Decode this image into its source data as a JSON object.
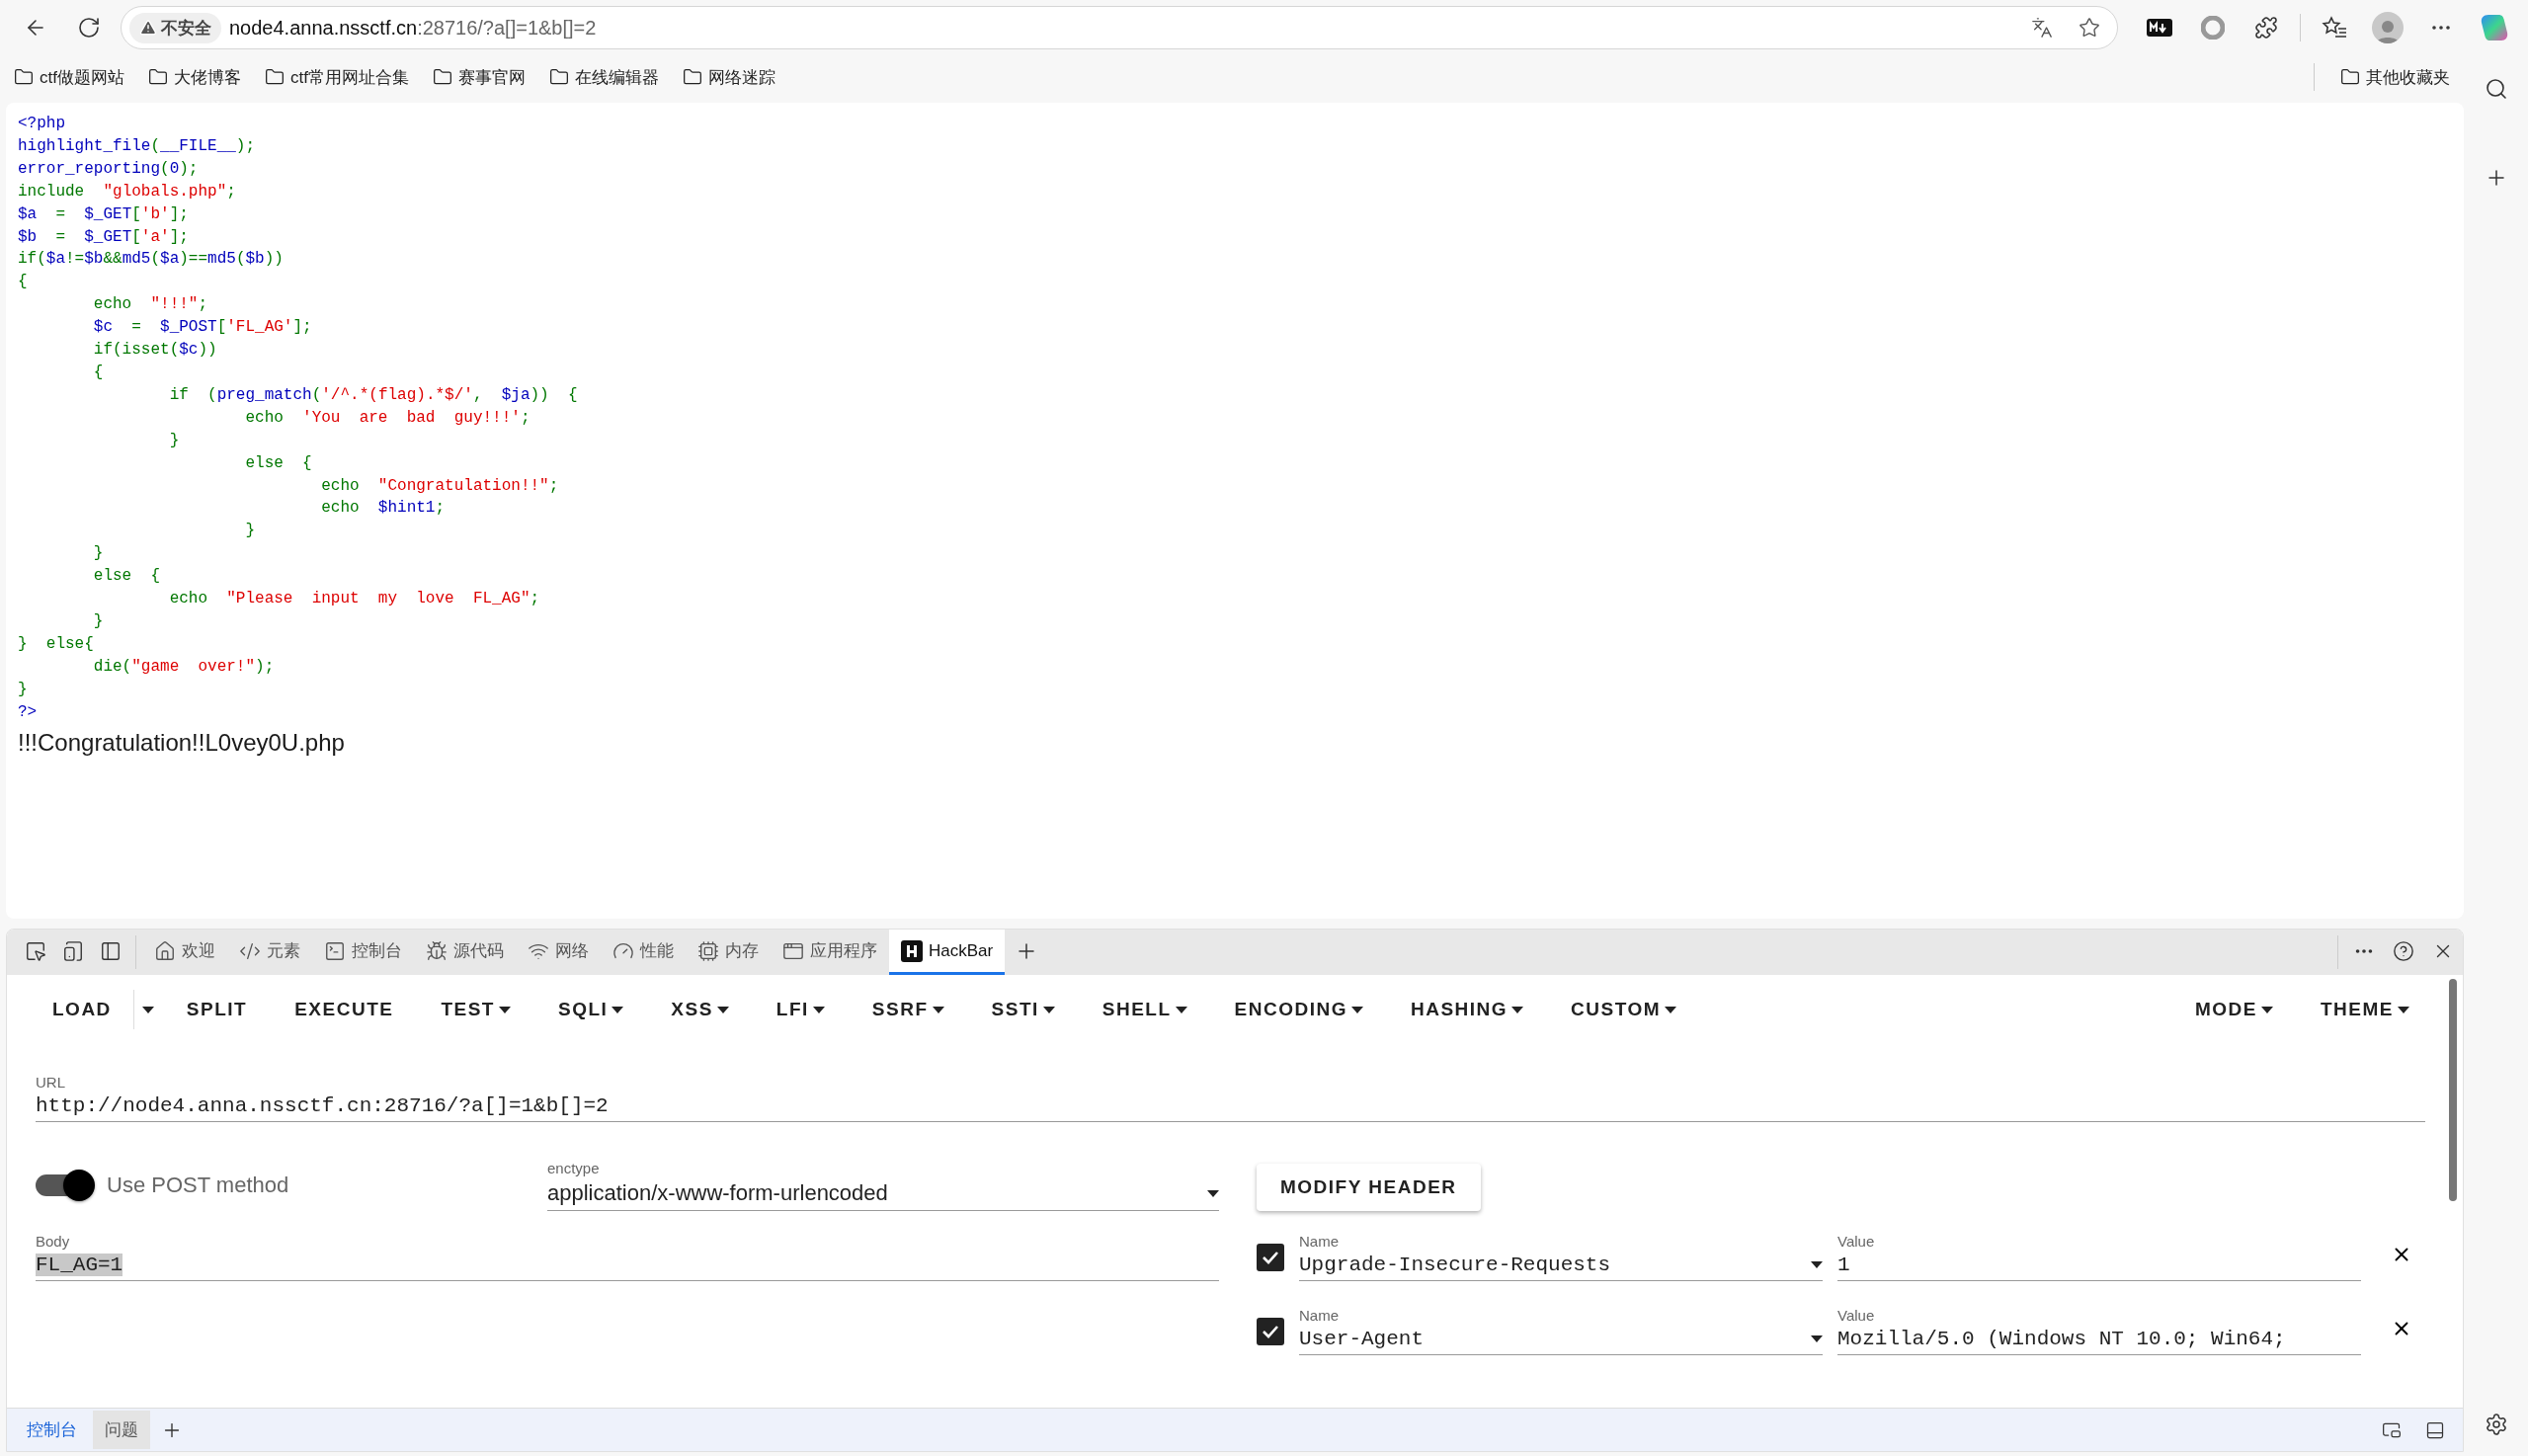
{
  "browser": {
    "address": {
      "security_label": "不安全",
      "host": "node4.anna.nssctf.cn",
      "path": ":28716/?a[]=1&b[]=2"
    },
    "bookmarks": [
      "ctf做题网站",
      "大佬博客",
      "ctf常用网址合集",
      "赛事官网",
      "在线编辑器",
      "网络迷踪"
    ],
    "other_bookmarks": "其他收藏夹"
  },
  "page": {
    "code_lines": [
      [
        {
          "kind": "default",
          "text": "<?php"
        }
      ],
      [
        {
          "kind": "default",
          "text": "highlight_file"
        },
        {
          "kind": "keyword",
          "text": "("
        },
        {
          "kind": "default",
          "text": "__FILE__"
        },
        {
          "kind": "keyword",
          "text": ");"
        }
      ],
      [
        {
          "kind": "default",
          "text": "error_reporting"
        },
        {
          "kind": "keyword",
          "text": "("
        },
        {
          "kind": "default",
          "text": "0"
        },
        {
          "kind": "keyword",
          "text": ");"
        }
      ],
      [
        {
          "kind": "keyword",
          "text": "include  "
        },
        {
          "kind": "string",
          "text": "\"globals.php\""
        },
        {
          "kind": "keyword",
          "text": ";"
        }
      ],
      [
        {
          "kind": "default",
          "text": "$a  "
        },
        {
          "kind": "keyword",
          "text": "=  "
        },
        {
          "kind": "default",
          "text": "$_GET"
        },
        {
          "kind": "keyword",
          "text": "["
        },
        {
          "kind": "string",
          "text": "'b'"
        },
        {
          "kind": "keyword",
          "text": "];"
        }
      ],
      [
        {
          "kind": "default",
          "text": "$b  "
        },
        {
          "kind": "keyword",
          "text": "=  "
        },
        {
          "kind": "default",
          "text": "$_GET"
        },
        {
          "kind": "keyword",
          "text": "["
        },
        {
          "kind": "string",
          "text": "'a'"
        },
        {
          "kind": "keyword",
          "text": "];"
        }
      ],
      [
        {
          "kind": "keyword",
          "text": "if("
        },
        {
          "kind": "default",
          "text": "$a"
        },
        {
          "kind": "keyword",
          "text": "!="
        },
        {
          "kind": "default",
          "text": "$b"
        },
        {
          "kind": "keyword",
          "text": "&&"
        },
        {
          "kind": "default",
          "text": "md5"
        },
        {
          "kind": "keyword",
          "text": "("
        },
        {
          "kind": "default",
          "text": "$a"
        },
        {
          "kind": "keyword",
          "text": ")=="
        },
        {
          "kind": "default",
          "text": "md5"
        },
        {
          "kind": "keyword",
          "text": "("
        },
        {
          "kind": "default",
          "text": "$b"
        },
        {
          "kind": "keyword",
          "text": "))"
        }
      ],
      [
        {
          "kind": "keyword",
          "text": "{"
        }
      ],
      [
        {
          "kind": "keyword",
          "text": "        echo  "
        },
        {
          "kind": "string",
          "text": "\"!!!\""
        },
        {
          "kind": "keyword",
          "text": ";"
        }
      ],
      [
        {
          "kind": "default",
          "text": "        $c  "
        },
        {
          "kind": "keyword",
          "text": "=  "
        },
        {
          "kind": "default",
          "text": "$_POST"
        },
        {
          "kind": "keyword",
          "text": "["
        },
        {
          "kind": "string",
          "text": "'FL_AG'"
        },
        {
          "kind": "keyword",
          "text": "];"
        }
      ],
      [
        {
          "kind": "keyword",
          "text": "        if(isset("
        },
        {
          "kind": "default",
          "text": "$c"
        },
        {
          "kind": "keyword",
          "text": "))"
        }
      ],
      [
        {
          "kind": "keyword",
          "text": "        {"
        }
      ],
      [
        {
          "kind": "keyword",
          "text": "                if  ("
        },
        {
          "kind": "default",
          "text": "preg_match"
        },
        {
          "kind": "keyword",
          "text": "("
        },
        {
          "kind": "string",
          "text": "'/^.*(flag).*$/'"
        },
        {
          "kind": "keyword",
          "text": ",  "
        },
        {
          "kind": "default",
          "text": "$ja"
        },
        {
          "kind": "keyword",
          "text": "))  {"
        }
      ],
      [
        {
          "kind": "keyword",
          "text": "                        echo  "
        },
        {
          "kind": "string",
          "text": "'You  are  bad  guy!!!'"
        },
        {
          "kind": "keyword",
          "text": ";"
        }
      ],
      [
        {
          "kind": "keyword",
          "text": "                }"
        }
      ],
      [
        {
          "kind": "keyword",
          "text": "                        else  {"
        }
      ],
      [
        {
          "kind": "keyword",
          "text": "                                echo  "
        },
        {
          "kind": "string",
          "text": "\"Congratulation!!\""
        },
        {
          "kind": "keyword",
          "text": ";"
        }
      ],
      [
        {
          "kind": "keyword",
          "text": "                                echo  "
        },
        {
          "kind": "default",
          "text": "$hint1"
        },
        {
          "kind": "keyword",
          "text": ";"
        }
      ],
      [
        {
          "kind": "keyword",
          "text": "                        }"
        }
      ],
      [
        {
          "kind": "keyword",
          "text": "        }"
        }
      ],
      [
        {
          "kind": "keyword",
          "text": "        else  {"
        }
      ],
      [
        {
          "kind": "keyword",
          "text": "                echo  "
        },
        {
          "kind": "string",
          "text": "\"Please  input  my  love  FL_AG\""
        },
        {
          "kind": "keyword",
          "text": ";"
        }
      ],
      [
        {
          "kind": "keyword",
          "text": "        }"
        }
      ],
      [
        {
          "kind": "keyword",
          "text": "}  else{"
        }
      ],
      [
        {
          "kind": "keyword",
          "text": "        die("
        },
        {
          "kind": "string",
          "text": "\"game  over!\""
        },
        {
          "kind": "keyword",
          "text": ");"
        }
      ],
      [
        {
          "kind": "keyword",
          "text": "}"
        }
      ],
      [
        {
          "kind": "default",
          "text": "?>"
        }
      ]
    ],
    "output": "!!!Congratulation!!L0vey0U.php"
  },
  "devtools": {
    "tabs": [
      {
        "label": "欢迎",
        "selected": false
      },
      {
        "label": "元素",
        "selected": false
      },
      {
        "label": "控制台",
        "selected": false
      },
      {
        "label": "源代码",
        "selected": false
      },
      {
        "label": "网络",
        "selected": false
      },
      {
        "label": "性能",
        "selected": false
      },
      {
        "label": "内存",
        "selected": false
      },
      {
        "label": "应用程序",
        "selected": false
      },
      {
        "label": "HackBar",
        "selected": true
      }
    ],
    "hackbar": {
      "menu": [
        {
          "label": "LOAD",
          "kind": "split"
        },
        {
          "label": "SPLIT",
          "kind": "plain"
        },
        {
          "label": "EXECUTE",
          "kind": "plain"
        },
        {
          "label": "TEST",
          "kind": "dropdown"
        },
        {
          "label": "SQLI",
          "kind": "dropdown"
        },
        {
          "label": "XSS",
          "kind": "dropdown"
        },
        {
          "label": "LFI",
          "kind": "dropdown"
        },
        {
          "label": "SSRF",
          "kind": "dropdown"
        },
        {
          "label": "SSTI",
          "kind": "dropdown"
        },
        {
          "label": "SHELL",
          "kind": "dropdown"
        },
        {
          "label": "ENCODING",
          "kind": "dropdown"
        },
        {
          "label": "HASHING",
          "kind": "dropdown"
        },
        {
          "label": "CUSTOM",
          "kind": "dropdown"
        }
      ],
      "menu_right": [
        {
          "label": "MODE",
          "kind": "dropdown"
        },
        {
          "label": "THEME",
          "kind": "dropdown"
        }
      ],
      "url": {
        "label": "URL",
        "value": "http://node4.anna.nssctf.cn:28716/?a[]=1&b[]=2"
      },
      "post_method": {
        "label": "Use POST method",
        "on": true
      },
      "enctype": {
        "label": "enctype",
        "value": "application/x-www-form-urlencoded"
      },
      "modify_header": "MODIFY HEADER",
      "body": {
        "label": "Body",
        "value": "FL_AG=1",
        "highlighted": true
      },
      "headers": [
        {
          "checked": true,
          "name_label": "Name",
          "name": "Upgrade-Insecure-Requests",
          "value_label": "Value",
          "value": "1"
        },
        {
          "checked": true,
          "name_label": "Name",
          "name": "User-Agent",
          "value_label": "Value",
          "value": "Mozilla/5.0 (Windows NT 10.0; Win64;"
        }
      ]
    },
    "drawer_tabs": [
      {
        "label": "控制台",
        "selected": true
      },
      {
        "label": "问题",
        "selected": false
      }
    ]
  }
}
